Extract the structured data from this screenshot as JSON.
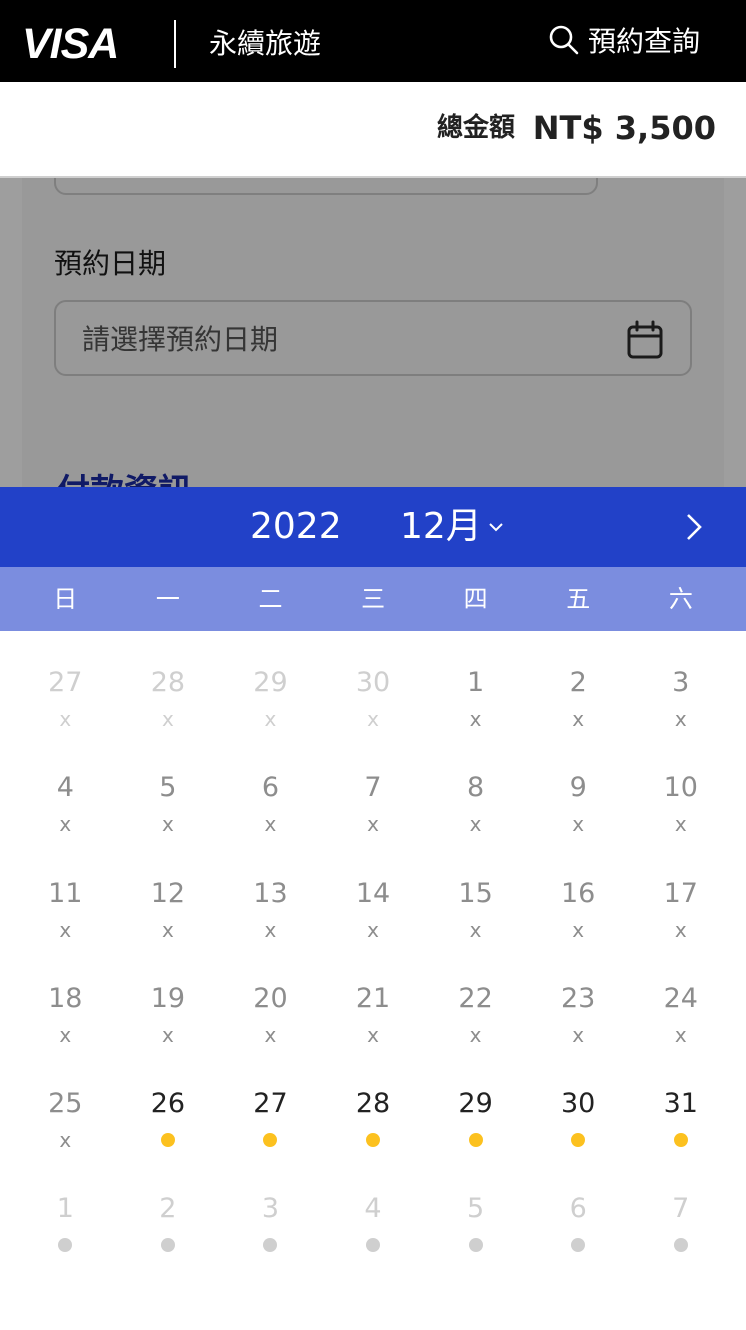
{
  "header": {
    "logo": "VISA",
    "brand": "永續旅遊",
    "search_label": "預約查詢"
  },
  "total": {
    "label": "總金額",
    "amount": "NT$ 3,500"
  },
  "form": {
    "date_label": "預約日期",
    "date_placeholder": "請選擇預約日期",
    "section_title": "付款資訊"
  },
  "calendar": {
    "year": "2022",
    "month": "12月",
    "weekdays": [
      "日",
      "一",
      "二",
      "三",
      "四",
      "五",
      "六"
    ],
    "unavailable_mark": "x",
    "accent_color": "#2241c8",
    "weekday_bar_color": "#7b8ddf",
    "available_dot_color": "#fcc11f",
    "weeks": [
      [
        {
          "day": "27",
          "state": "prev"
        },
        {
          "day": "28",
          "state": "prev"
        },
        {
          "day": "29",
          "state": "prev"
        },
        {
          "day": "30",
          "state": "prev"
        },
        {
          "day": "1",
          "state": "closed"
        },
        {
          "day": "2",
          "state": "closed"
        },
        {
          "day": "3",
          "state": "closed"
        }
      ],
      [
        {
          "day": "4",
          "state": "closed"
        },
        {
          "day": "5",
          "state": "closed"
        },
        {
          "day": "6",
          "state": "closed"
        },
        {
          "day": "7",
          "state": "closed"
        },
        {
          "day": "8",
          "state": "closed"
        },
        {
          "day": "9",
          "state": "closed"
        },
        {
          "day": "10",
          "state": "closed"
        }
      ],
      [
        {
          "day": "11",
          "state": "closed"
        },
        {
          "day": "12",
          "state": "closed"
        },
        {
          "day": "13",
          "state": "closed"
        },
        {
          "day": "14",
          "state": "closed"
        },
        {
          "day": "15",
          "state": "closed"
        },
        {
          "day": "16",
          "state": "closed"
        },
        {
          "day": "17",
          "state": "closed"
        }
      ],
      [
        {
          "day": "18",
          "state": "closed"
        },
        {
          "day": "19",
          "state": "closed"
        },
        {
          "day": "20",
          "state": "closed"
        },
        {
          "day": "21",
          "state": "closed"
        },
        {
          "day": "22",
          "state": "closed"
        },
        {
          "day": "23",
          "state": "closed"
        },
        {
          "day": "24",
          "state": "closed"
        }
      ],
      [
        {
          "day": "25",
          "state": "closed"
        },
        {
          "day": "26",
          "state": "open"
        },
        {
          "day": "27",
          "state": "open"
        },
        {
          "day": "28",
          "state": "open"
        },
        {
          "day": "29",
          "state": "open"
        },
        {
          "day": "30",
          "state": "open"
        },
        {
          "day": "31",
          "state": "open"
        }
      ],
      [
        {
          "day": "1",
          "state": "next"
        },
        {
          "day": "2",
          "state": "next"
        },
        {
          "day": "3",
          "state": "next"
        },
        {
          "day": "4",
          "state": "next"
        },
        {
          "day": "5",
          "state": "next"
        },
        {
          "day": "6",
          "state": "next"
        },
        {
          "day": "7",
          "state": "next"
        }
      ]
    ]
  }
}
